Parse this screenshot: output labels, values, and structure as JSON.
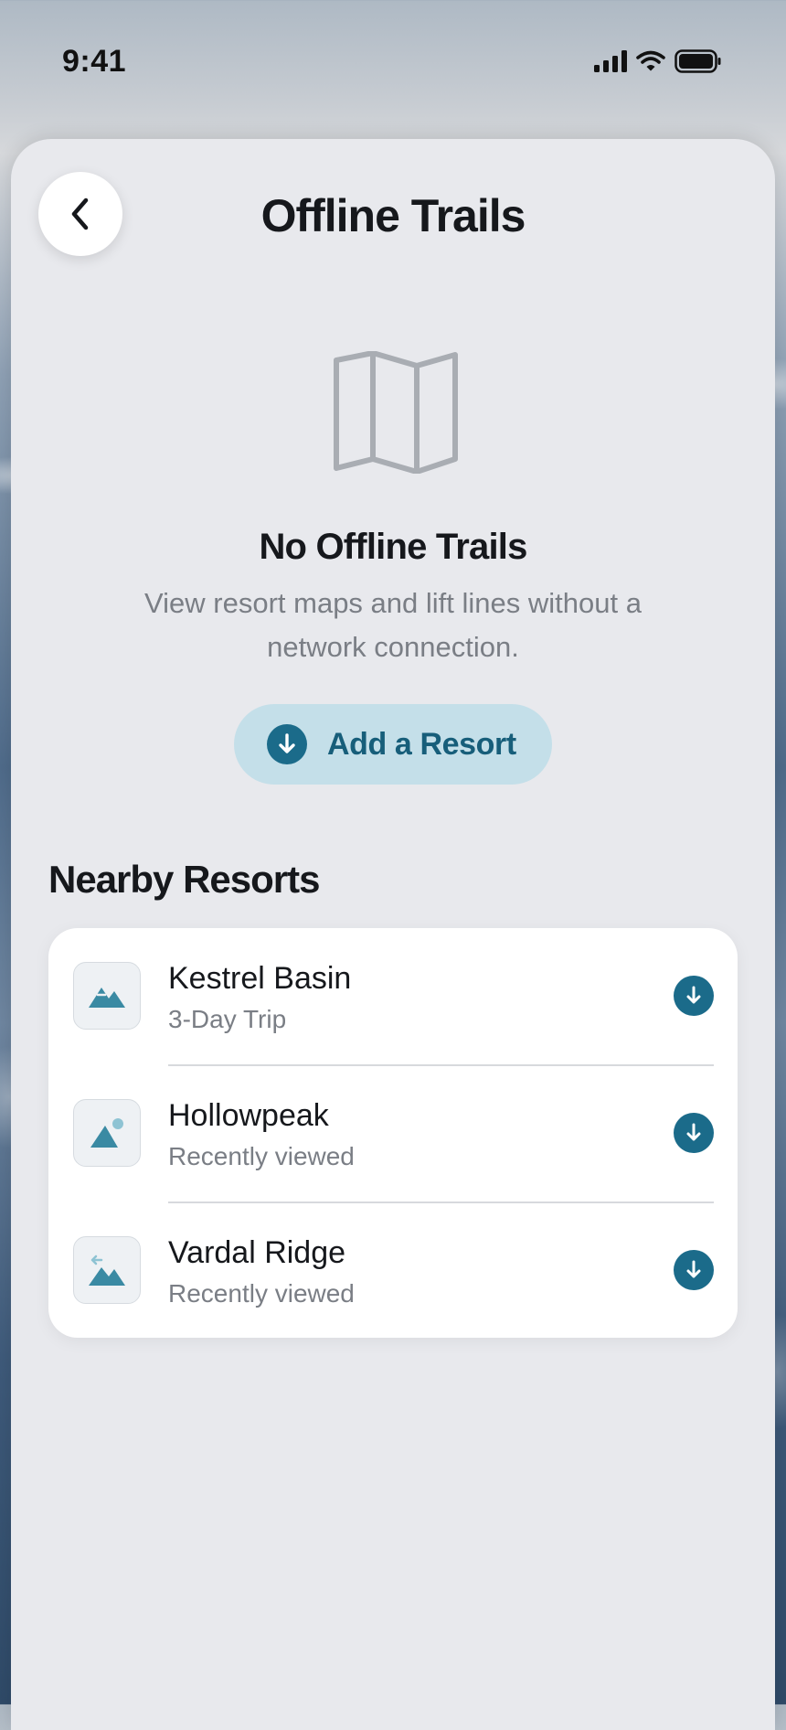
{
  "status_bar": {
    "time": "9:41"
  },
  "header": {
    "title": "Offline Trails",
    "back_icon": "chevron-left-icon"
  },
  "empty_state": {
    "icon": "folded-map-icon",
    "title": "No Offline Trails",
    "subtitle": "View resort maps and lift lines without a network connection.",
    "button_label": "Add a Resort",
    "button_icon": "download-circle-icon"
  },
  "nearby": {
    "title": "Nearby Resorts",
    "items": [
      {
        "name": "Kestrel Basin",
        "subtitle": "3-Day Trip",
        "icon": "mountain-icon"
      },
      {
        "name": "Hollowpeak",
        "subtitle": "Recently viewed",
        "icon": "mountain-sun-icon"
      },
      {
        "name": "Vardal Ridge",
        "subtitle": "Recently viewed",
        "icon": "mountain-arrow-icon"
      }
    ]
  },
  "colors": {
    "accent": "#1b6b8a",
    "accent_soft": "#c4dfe9",
    "sheet_bg": "#e8e9ed",
    "muted_text": "#7a7e85"
  }
}
